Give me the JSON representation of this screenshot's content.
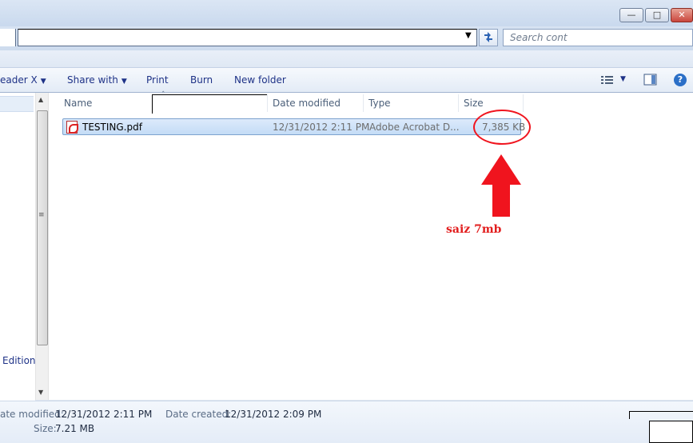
{
  "window": {
    "controls": {
      "minimize_icon": "minimize-icon",
      "maximize_icon": "maximize-icon",
      "close_icon": "close-icon"
    }
  },
  "address": {
    "path": "",
    "search_placeholder": "Search cont"
  },
  "toolbar": {
    "open_with": "eader X",
    "share": "Share with",
    "print": "Print",
    "burn": "Burn",
    "new_folder": "New folder"
  },
  "columns": {
    "name": "Name",
    "date_modified": "Date modified",
    "type": "Type",
    "size": "Size"
  },
  "files": [
    {
      "name": "TESTING.pdf",
      "date_modified": "12/31/2012 2:11 PM",
      "type": "Adobe Acrobat D...",
      "size": "7,385 KB",
      "icon": "pdf-icon"
    }
  ],
  "navpane": {
    "visible_item": "Edition"
  },
  "annotation": {
    "text": "saiz 7mb",
    "color": "#e21e1e"
  },
  "details": {
    "date_modified_label": "ate modified:",
    "date_modified": "12/31/2012 2:11 PM",
    "date_created_label": "Date created:",
    "date_created": "12/31/2012 2:09 PM",
    "size_label": "Size:",
    "size": "7.21 MB"
  },
  "colors": {
    "toolbar_text": "#1e3287",
    "selection": "#c4dcf6",
    "annotation": "#f0141e"
  }
}
